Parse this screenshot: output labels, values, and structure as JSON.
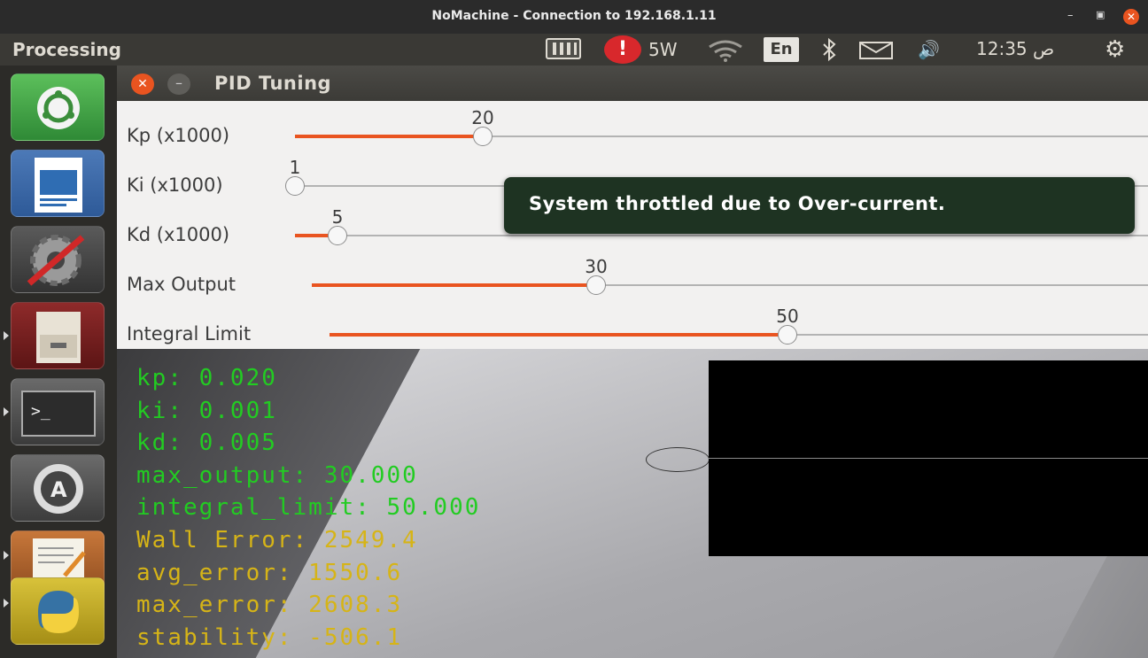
{
  "nx_window": {
    "title": "NoMachine - Connection to 192.168.1.11"
  },
  "panel": {
    "app_name": "Processing",
    "power_label": "5W",
    "keyboard_layout": "En",
    "clock": "12:35 ص",
    "icons": [
      "nomachine-icon",
      "alert-icon",
      "wifi-icon",
      "bluetooth-icon",
      "mail-icon",
      "volume-icon",
      "power-gear-icon"
    ]
  },
  "launcher": {
    "items": [
      "ubuntu-dash",
      "libreoffice-impress",
      "system-settings",
      "file-cabinet",
      "terminal",
      "software-updater",
      "text-editor",
      "python"
    ]
  },
  "pid_window": {
    "title": "PID Tuning",
    "sliders": [
      {
        "label": "Kp (x1000)",
        "value": "20",
        "fraction": 0.22
      },
      {
        "label": "Ki (x1000)",
        "value": "1",
        "fraction": 0.0
      },
      {
        "label": "Kd (x1000)",
        "value": "5",
        "fraction": 0.05
      },
      {
        "label": "Max Output",
        "value": "30",
        "fraction": 0.34
      },
      {
        "label": "Integral Limit",
        "value": "50",
        "fraction": 0.56
      }
    ]
  },
  "notification": {
    "text": "System throttled due to Over-current."
  },
  "overlay_text": {
    "green": [
      "kp: 0.020",
      "ki: 0.001",
      "kd: 0.005",
      "max_output: 30.000",
      "integral_limit: 50.000"
    ],
    "yellow": [
      "Wall Error: 2549.4",
      "avg_error: 1550.6",
      "max_error: 2608.3",
      "stability: -506.1"
    ],
    "colors": {
      "green": "#22cc22",
      "yellow": "#d6b417"
    }
  },
  "accent": "#e95420"
}
